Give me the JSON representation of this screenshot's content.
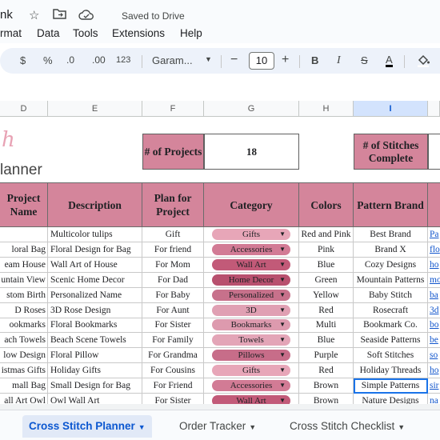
{
  "titlebar": {
    "doc_title": "nk",
    "star_icon": "star-icon",
    "folder_icon": "move-folder-icon",
    "cloud_icon": "cloud-saved-icon",
    "saved_text": "Saved to Drive"
  },
  "menu": [
    "rmat",
    "Data",
    "Tools",
    "Extensions",
    "Help"
  ],
  "toolbar": {
    "currency": "$",
    "percent": "%",
    "decrease_decimal": ".0",
    "increase_decimal": ".00",
    "number_format": "123",
    "font": "Garam...",
    "minus": "−",
    "font_size": "10",
    "plus": "+",
    "bold": "B",
    "italic": "I",
    "strike": "S",
    "text_color": "A"
  },
  "columns": [
    "D",
    "E",
    "F",
    "G",
    "H",
    "I"
  ],
  "selected_column": "I",
  "logo": {
    "h": "h",
    "planner": "lanner"
  },
  "summary": {
    "projects_label": "# of Projects",
    "projects_value": "18",
    "stitches_label": "# of Stitches Complete"
  },
  "headers": [
    "Project Name",
    "Description",
    "Plan for Project",
    "Category",
    "Colors",
    "Pattern Brand"
  ],
  "category_colors": {
    "Gifts": "#e7a6b8",
    "Accessories": "#d27b95",
    "Wall Art": "#c25a78",
    "Home Decor": "#b8506e",
    "Personalized": "#c7718b",
    "3D": "#e0a0b3",
    "Bookmarks": "#dd9aae",
    "Towels": "#e3a5b7",
    "Pillows": "#c76d89"
  },
  "rows": [
    {
      "name": "",
      "desc": "Multicolor tulips",
      "plan": "Gift",
      "cat": "Gifts",
      "colors": "Red and Pink",
      "brand": "Best Brand",
      "link": "Pa"
    },
    {
      "name": "loral Bag",
      "desc": "Floral Design for Bag",
      "plan": "For friend",
      "cat": "Accessories",
      "colors": "Pink",
      "brand": "Brand X",
      "link": "flo"
    },
    {
      "name": "eam House",
      "desc": "Wall Art of House",
      "plan": "For Mom",
      "cat": "Wall Art",
      "colors": "Blue",
      "brand": "Cozy Designs",
      "link": "ho"
    },
    {
      "name": "untain View",
      "desc": "Scenic Home Decor",
      "plan": "For Dad",
      "cat": "Home Decor",
      "colors": "Green",
      "brand": "Mountain Patterns",
      "link": "mo"
    },
    {
      "name": "stom Birth",
      "desc": "Personalized Name",
      "plan": "For Baby",
      "cat": "Personalized",
      "colors": "Yellow",
      "brand": "Baby Stitch",
      "link": "ba"
    },
    {
      "name": "D Roses",
      "desc": "3D Rose Design",
      "plan": "For Aunt",
      "cat": "3D",
      "colors": "Red",
      "brand": "Rosecraft",
      "link": "3d"
    },
    {
      "name": "ookmarks",
      "desc": "Floral Bookmarks",
      "plan": "For Sister",
      "cat": "Bookmarks",
      "colors": "Multi",
      "brand": "Bookmark Co.",
      "link": "bo"
    },
    {
      "name": "ach Towels",
      "desc": "Beach Scene Towels",
      "plan": "For Family",
      "cat": "Towels",
      "colors": "Blue",
      "brand": "Seaside Patterns",
      "link": "be"
    },
    {
      "name": "low Design",
      "desc": "Floral Pillow",
      "plan": "For Grandma",
      "cat": "Pillows",
      "colors": "Purple",
      "brand": "Soft Stitches",
      "link": "so"
    },
    {
      "name": "istmas Gifts",
      "desc": "Holiday Gifts",
      "plan": "For Cousins",
      "cat": "Gifts",
      "colors": "Red",
      "brand": "Holiday Threads",
      "link": "ho"
    },
    {
      "name": "mall Bag",
      "desc": "Small Design for Bag",
      "plan": "For Friend",
      "cat": "Accessories",
      "colors": "Brown",
      "brand": "Simple Patterns",
      "link": "sir"
    },
    {
      "name": "all Art Owl",
      "desc": "Owl Wall Art",
      "plan": "For Sister",
      "cat": "Wall Art",
      "colors": "Brown",
      "brand": "Nature Designs",
      "link": "na"
    }
  ],
  "sheets": [
    {
      "label": "Cross Stitch Planner",
      "active": true
    },
    {
      "label": "Order Tracker",
      "active": false
    },
    {
      "label": "Cross Stitch Checklist",
      "active": false
    }
  ]
}
